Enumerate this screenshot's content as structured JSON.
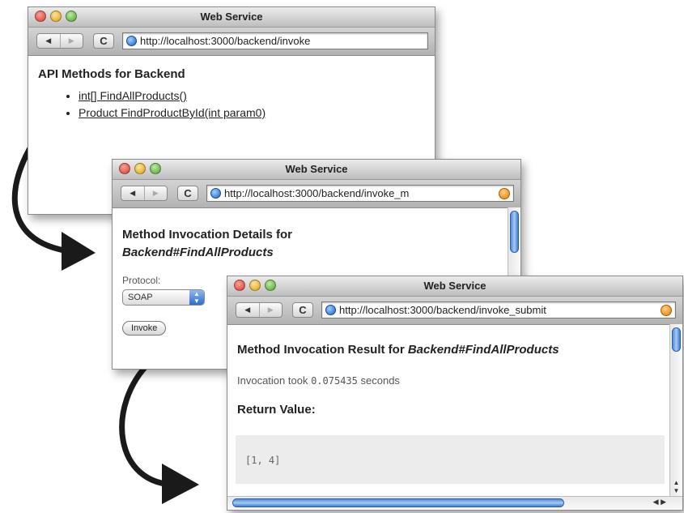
{
  "windows": [
    {
      "title": "Web Service",
      "nav_back": "◀",
      "nav_forward": "▶",
      "reload": "C",
      "url": "http://localhost:3000/backend/invoke",
      "heading": "API Methods for Backend",
      "methods": [
        "int[] FindAllProducts()",
        "Product FindProductById(int param0)"
      ]
    },
    {
      "title": "Web Service",
      "nav_back": "◀",
      "nav_forward": "▶",
      "reload": "C",
      "url": "http://localhost:3000/backend/invoke_m",
      "heading_prefix": "Method Invocation Details for",
      "heading_method": "Backend#FindAllProducts",
      "protocol_label": "Protocol:",
      "protocol_value": "SOAP",
      "invoke_label": "Invoke"
    },
    {
      "title": "Web Service",
      "nav_back": "◀",
      "nav_forward": "▶",
      "reload": "C",
      "url": "http://localhost:3000/backend/invoke_submit",
      "heading_prefix": "Method Invocation Result for",
      "heading_method": "Backend#FindAllProducts",
      "time_prefix": "Invocation took",
      "time_value": "0.075435",
      "time_suffix": "seconds",
      "return_heading": "Return Value:",
      "return_value": "[1, 4]"
    }
  ],
  "colors": {
    "arrow": "#1a1a1a",
    "scroll_accent": "#4f8ad9"
  }
}
